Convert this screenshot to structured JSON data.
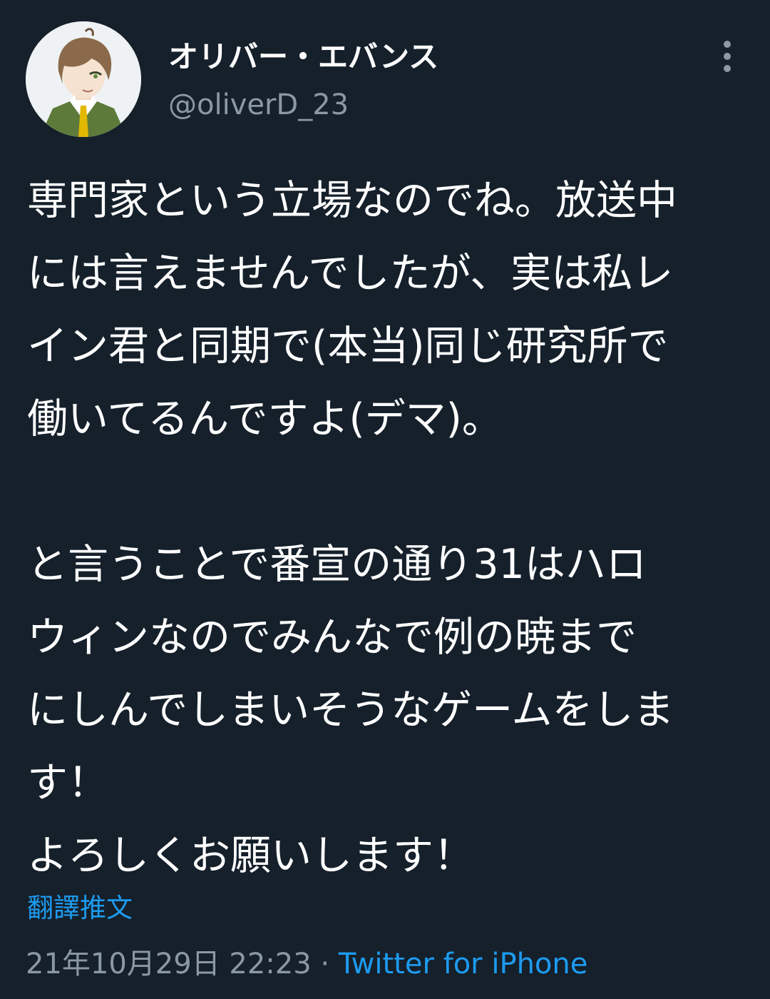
{
  "author": {
    "display_name": "オリバー・エバンス",
    "handle": "@oliverD_23"
  },
  "tweet": {
    "lines": [
      "専門家という立場なのでね。放送中",
      "には言えませんでしたが、実は私レ",
      "イン君と同期で(本当)同じ研究所で",
      "働いてるんですよ(デマ)。",
      "",
      "と言うことで番宣の通り31はハロ",
      "ウィンなのでみんなで例の暁まで",
      "にしんでしまいそうなゲームをしま",
      "す！",
      "よろしくお願いします！"
    ]
  },
  "translate_label": "翻譯推文",
  "meta": {
    "timestamp": "21年10月29日 22:23",
    "separator": " · ",
    "source": "Twitter for iPhone"
  },
  "icons": {
    "avatar": "anime-character-avatar",
    "more": "more-vertical-icon"
  },
  "colors": {
    "background": "#15202b",
    "text": "#ffffff",
    "secondary": "#8b98a5",
    "link": "#1d9bf0"
  }
}
